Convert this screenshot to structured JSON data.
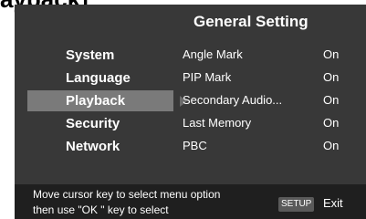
{
  "page": {
    "title": "ayback]"
  },
  "menu": {
    "title": "General Setting"
  },
  "left_menu": [
    {
      "label": "System"
    },
    {
      "label": "Language"
    },
    {
      "label": "Playback"
    },
    {
      "label": "Security"
    },
    {
      "label": "Network"
    }
  ],
  "selected_index": 2,
  "options": [
    {
      "name": "Angle Mark",
      "value": "On"
    },
    {
      "name": "PIP Mark",
      "value": "On"
    },
    {
      "name": "Secondary Audio...",
      "value": "On"
    },
    {
      "name": "Last Memory",
      "value": "On"
    },
    {
      "name": "PBC",
      "value": "On"
    }
  ],
  "footer": {
    "hint_line1": "Move cursor key to select menu option",
    "hint_line2": "then use \"OK \" key to select",
    "setup_key": "SETUP",
    "exit_label": "Exit"
  }
}
